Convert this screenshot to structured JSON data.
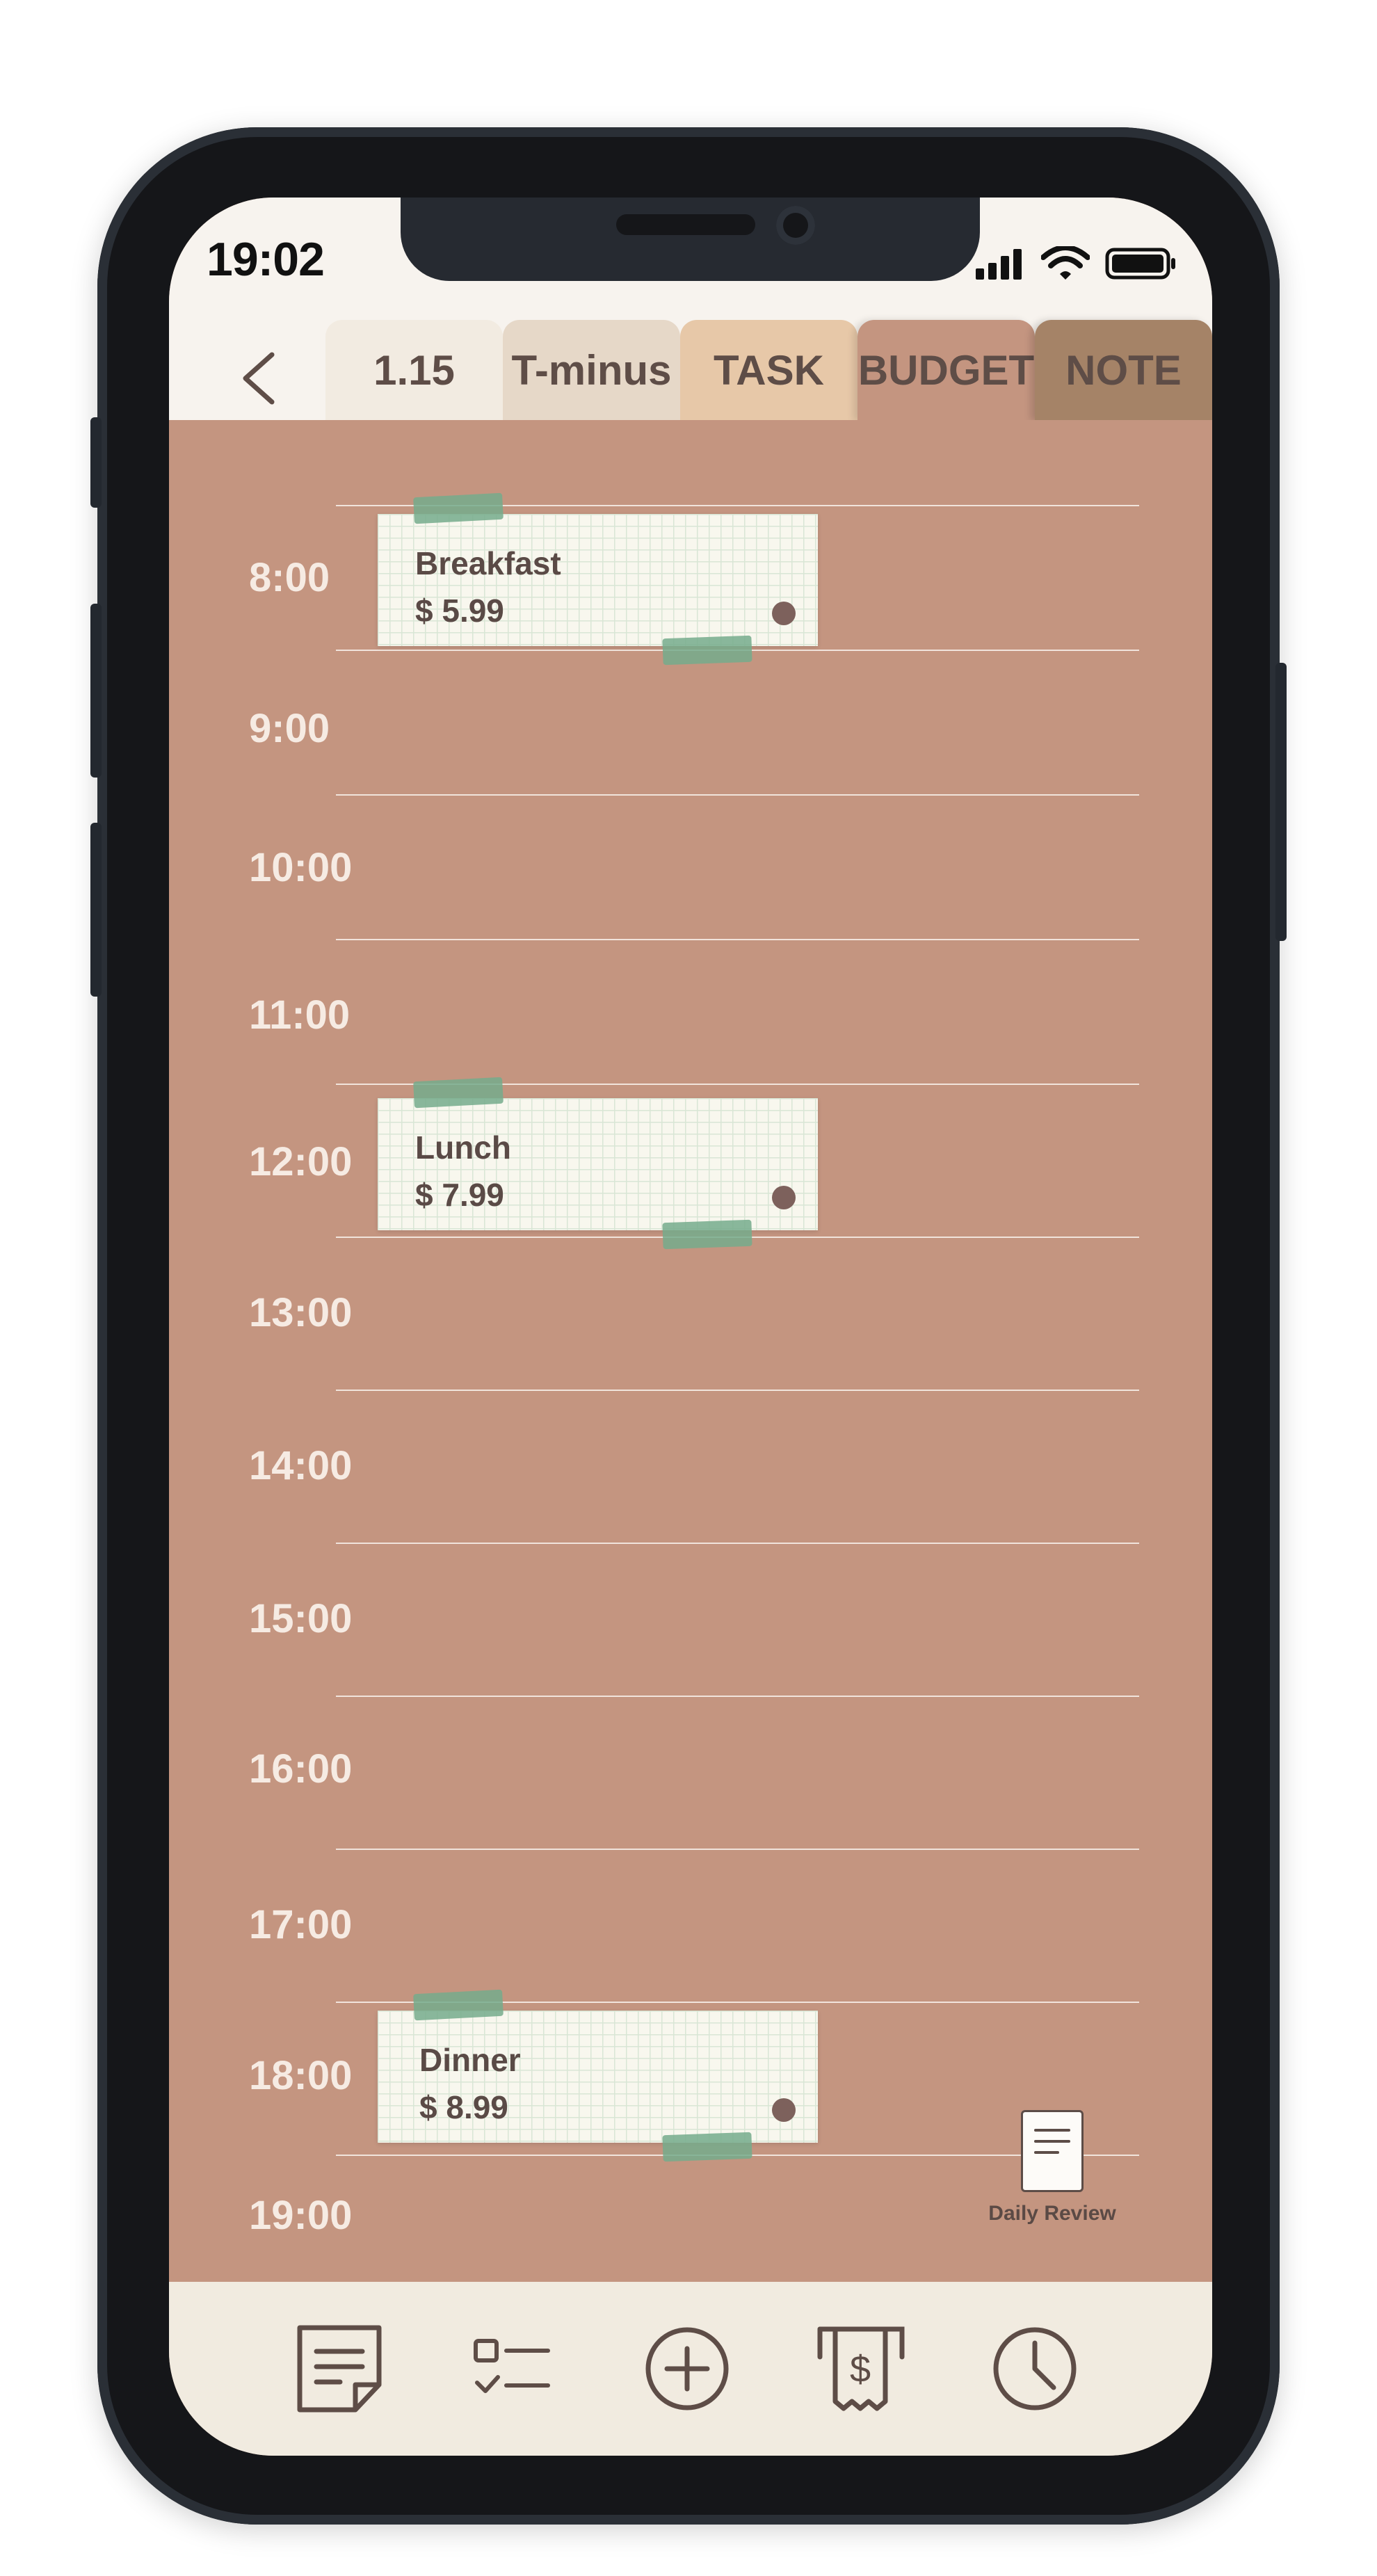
{
  "status_bar": {
    "time": "19:02"
  },
  "tabs": [
    {
      "label": "1.15",
      "color": "#f2ebe1"
    },
    {
      "label": "T-minus",
      "color": "#e6d8c8"
    },
    {
      "label": "TASK",
      "color": "#e7c8a8"
    },
    {
      "label": "BUDGET",
      "color": "#c49580"
    },
    {
      "label": "NOTE",
      "color": "#a58367"
    }
  ],
  "active_tab": "BUDGET",
  "hours": [
    "8:00",
    "9:00",
    "10:00",
    "11:00",
    "12:00",
    "13:00",
    "14:00",
    "15:00",
    "16:00",
    "17:00",
    "18:00",
    "19:00"
  ],
  "entries": [
    {
      "name": "Breakfast",
      "price": "$ 5.99",
      "time": "8:00"
    },
    {
      "name": "Lunch",
      "price": "$ 7.99",
      "time": "12:00"
    },
    {
      "name": "Dinner",
      "price": "$ 8.99",
      "time": "18:00"
    }
  ],
  "daily_review": {
    "label": "Daily Review"
  },
  "bottom_nav": [
    {
      "name": "note-icon"
    },
    {
      "name": "checklist-icon"
    },
    {
      "name": "add-icon"
    },
    {
      "name": "receipt-dollar-icon"
    },
    {
      "name": "clock-icon"
    }
  ],
  "colors": {
    "background": "#c49580",
    "header": "#f7f3ee",
    "bottom_bar": "#f1ebe0",
    "text": "#5e4d47"
  }
}
